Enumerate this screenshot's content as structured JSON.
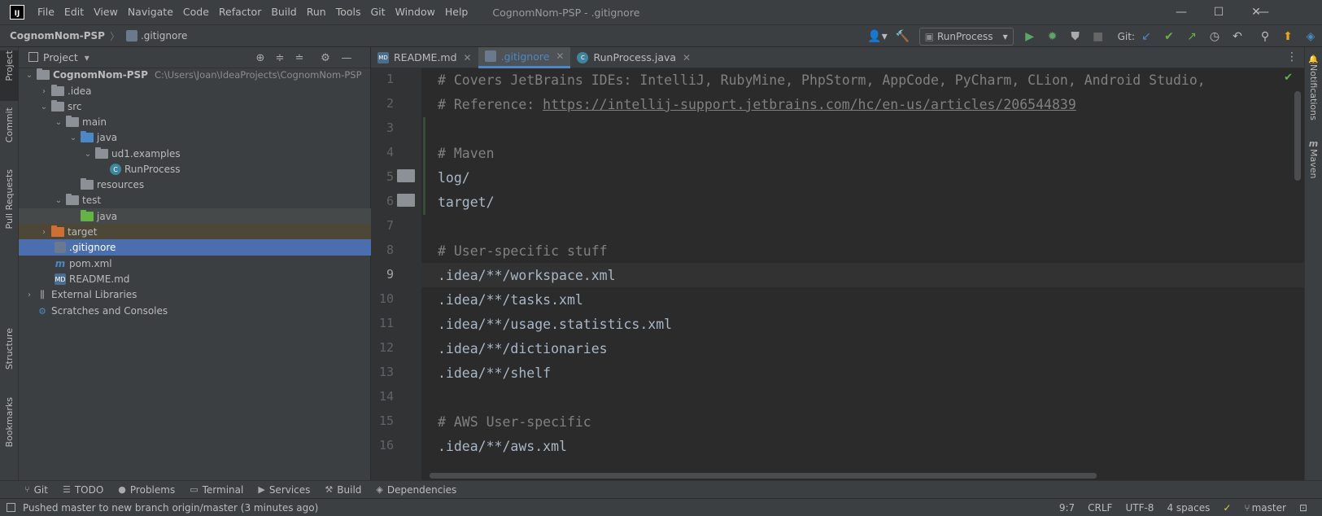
{
  "window": {
    "title": "CognomNom-PSP - .gitignore",
    "minimize_glyph": "—",
    "maximize_glyph": "☐",
    "close_glyph": "✕"
  },
  "menu": [
    "File",
    "Edit",
    "View",
    "Navigate",
    "Code",
    "Refactor",
    "Build",
    "Run",
    "Tools",
    "Git",
    "Window",
    "Help"
  ],
  "breadcrumb": {
    "project": "CognomNom-PSP",
    "file": ".gitignore"
  },
  "toolbar": {
    "run_config": "RunProcess",
    "git_label": "Git:"
  },
  "left_strip": [
    "Project",
    "Commit",
    "Pull Requests",
    "Structure",
    "Bookmarks"
  ],
  "right_strip": [
    "Notifications",
    "Maven"
  ],
  "project_panel": {
    "title": "Project",
    "tree": [
      {
        "label": "CognomNom-PSP",
        "path": "C:\\Users\\Joan\\IdeaProjects\\CognomNom-PSP"
      },
      {
        "label": ".idea"
      },
      {
        "label": "src"
      },
      {
        "label": "main"
      },
      {
        "label": "java"
      },
      {
        "label": "ud1.examples"
      },
      {
        "label": "RunProcess"
      },
      {
        "label": "resources"
      },
      {
        "label": "test"
      },
      {
        "label": "java"
      },
      {
        "label": "target"
      },
      {
        "label": ".gitignore"
      },
      {
        "label": "pom.xml"
      },
      {
        "label": "README.md"
      },
      {
        "label": "External Libraries"
      },
      {
        "label": "Scratches and Consoles"
      }
    ]
  },
  "editor_tabs": [
    {
      "label": "README.md",
      "icon": "markdown-icon"
    },
    {
      "label": ".gitignore",
      "icon": "gitignore-icon",
      "active": true
    },
    {
      "label": "RunProcess.java",
      "icon": "java-class-icon"
    }
  ],
  "editor": {
    "line_numbers": [
      "1",
      "2",
      "3",
      "4",
      "5",
      "6",
      "7",
      "8",
      "9",
      "10",
      "11",
      "12",
      "13",
      "14",
      "15",
      "16"
    ],
    "comment1": "# Covers JetBrains IDEs: IntelliJ, RubyMine, PhpStorm, AppCode, PyCharm, CLion, Android Studio,",
    "comment2_prefix": "# Reference: ",
    "comment2_url": "https://intellij-support.jetbrains.com/hc/en-us/articles/206544839",
    "line4": "# Maven",
    "line5": "log/",
    "line6": "target/",
    "line8": "# User-specific stuff",
    "line9": ".idea/**/workspace.xml",
    "line10": ".idea/**/tasks.xml",
    "line11": ".idea/**/usage.statistics.xml",
    "line12": ".idea/**/dictionaries",
    "line13": ".idea/**/shelf",
    "line15": "# AWS User-specific",
    "line16": ".idea/**/aws.xml"
  },
  "bottom_tools": [
    "Git",
    "TODO",
    "Problems",
    "Terminal",
    "Services",
    "Build",
    "Dependencies"
  ],
  "status": {
    "message": "Pushed master to new branch origin/master (3 minutes ago)",
    "position": "9:7",
    "line_sep": "CRLF",
    "encoding": "UTF-8",
    "indent": "4 spaces",
    "branch": "master"
  }
}
